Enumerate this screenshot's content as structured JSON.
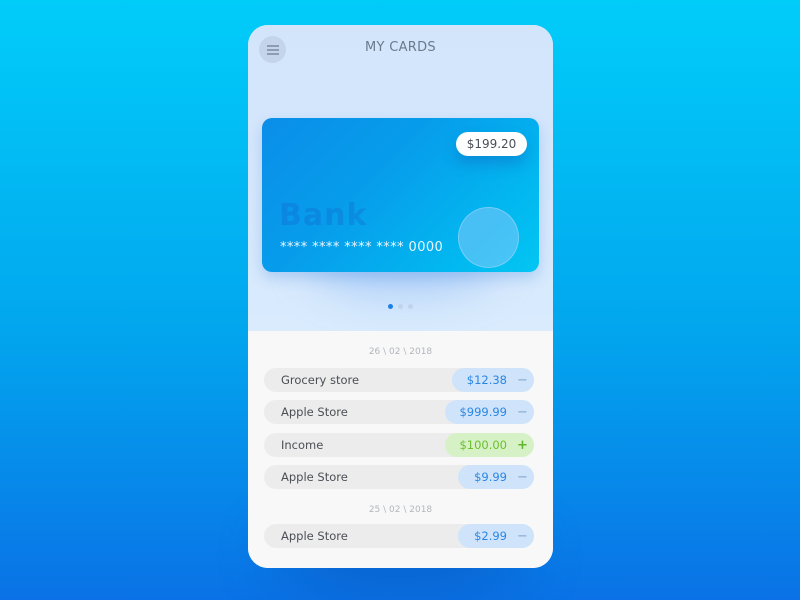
{
  "header": {
    "title": "MY CARDS",
    "menu_icon": "hamburger-menu-icon"
  },
  "card": {
    "balance": "$199.20",
    "bank_name": "Bank",
    "number": "**** **** **** **** 0000",
    "pager": {
      "total": 3,
      "active_index": 0
    }
  },
  "colors": {
    "debit_text": "#2a86e3",
    "debit_bg": "#cfe4fb",
    "credit_text": "#6bbf2b",
    "credit_bg": "#d7f1c6",
    "accent": "#1e7fe6"
  },
  "transactions": {
    "groups": [
      {
        "date": "26 \\ 02 \\ 2018",
        "items": [
          {
            "name": "Grocery store",
            "amount": "$12.38",
            "type": "debit",
            "sign": "−"
          },
          {
            "name": "Apple Store",
            "amount": "$999.99",
            "type": "debit",
            "sign": "−"
          },
          {
            "name": "Income",
            "amount": "$100.00",
            "type": "credit",
            "sign": "+"
          },
          {
            "name": "Apple Store",
            "amount": "$9.99",
            "type": "debit",
            "sign": "−"
          }
        ]
      },
      {
        "date": "25 \\ 02 \\ 2018",
        "items": [
          {
            "name": "Apple Store",
            "amount": "$2.99",
            "type": "debit",
            "sign": "−"
          }
        ]
      }
    ]
  }
}
